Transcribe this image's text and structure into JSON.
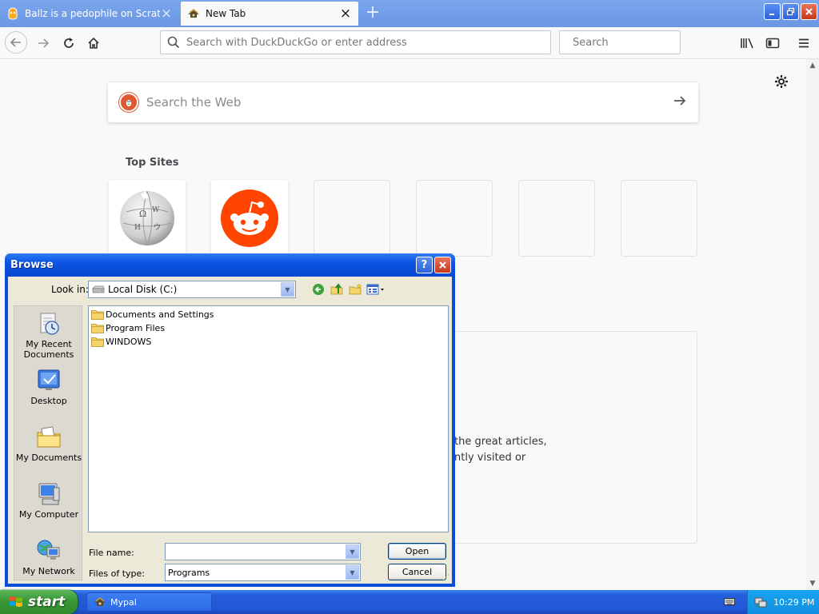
{
  "browser": {
    "tabs": [
      {
        "title": "Ballz is a pedophile on Scratch",
        "active": false,
        "favicon": "scratch-icon"
      },
      {
        "title": "New Tab",
        "active": true,
        "favicon": "mypal-icon"
      }
    ],
    "url_placeholder": "Search with DuckDuckGo or enter address",
    "search_placeholder": "Search",
    "accent": "#0a4ed8"
  },
  "newtab": {
    "web_search_placeholder": "Search the Web",
    "top_sites_title": "Top Sites",
    "top_sites": [
      {
        "name": "wikipedia",
        "icon": "wikipedia-globe-icon"
      },
      {
        "name": "reddit",
        "icon": "reddit-snoo-icon"
      },
      {
        "name": "",
        "icon": ""
      },
      {
        "name": "",
        "icon": ""
      },
      {
        "name": "",
        "icon": ""
      },
      {
        "name": "",
        "icon": ""
      }
    ],
    "highlights_line1": "the great articles,",
    "highlights_line2": "ntly visited or"
  },
  "dialog": {
    "title": "Browse",
    "look_in_label": "Look in:",
    "look_in_value": "Local Disk (C:)",
    "places": [
      {
        "label": "My Recent Documents",
        "icon": "recent-documents-icon"
      },
      {
        "label": "Desktop",
        "icon": "desktop-icon"
      },
      {
        "label": "My Documents",
        "icon": "my-documents-icon"
      },
      {
        "label": "My Computer",
        "icon": "my-computer-icon"
      },
      {
        "label": "My Network",
        "icon": "my-network-icon"
      }
    ],
    "files": [
      "Documents and Settings",
      "Program Files",
      "WINDOWS"
    ],
    "file_name_label": "File name:",
    "file_name_value": "",
    "files_of_type_label": "Files of type:",
    "files_of_type_value": "Programs",
    "open_label": "Open",
    "cancel_label": "Cancel"
  },
  "taskbar": {
    "start_label": "start",
    "items": [
      {
        "label": "Mypal"
      }
    ],
    "clock": "10:29 PM"
  }
}
